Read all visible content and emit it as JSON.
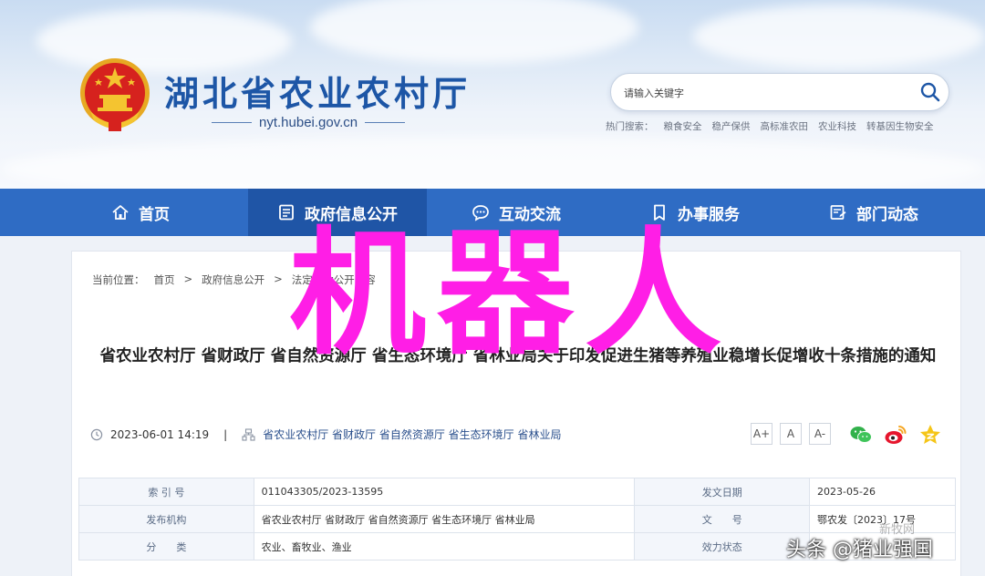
{
  "header": {
    "site_title": "湖北省农业农村厅",
    "site_domain": "nyt.hubei.gov.cn",
    "search_placeholder": "请输入关键字",
    "hot_label": "热门搜索：",
    "hot_terms": [
      "粮食安全",
      "稳产保供",
      "高标准农田",
      "农业科技",
      "转基因生物安全"
    ]
  },
  "nav": {
    "items": [
      {
        "label": "首页",
        "icon": "home-icon"
      },
      {
        "label": "政府信息公开",
        "icon": "document-icon"
      },
      {
        "label": "互动交流",
        "icon": "chat-icon"
      },
      {
        "label": "办事服务",
        "icon": "bookmark-icon"
      },
      {
        "label": "部门动态",
        "icon": "news-icon"
      }
    ],
    "active_index": 1,
    "bg_color": "#2f6cc4"
  },
  "breadcrumb": {
    "prefix": "当前位置：",
    "items": [
      "首页",
      "政府信息公开",
      "法定主动公开内容"
    ]
  },
  "article": {
    "title": "省农业农村厅 省财政厅 省自然资源厅 省生态环境厅 省林业局关于印发促进生猪等养殖业稳增长促增收十条措施的通知",
    "date": "2023-06-01 14:19",
    "separator": "|",
    "publishers": "省农业农村厅 省财政厅 省自然资源厅 省生态环境厅 省林业局",
    "font_sizes": [
      "A+",
      "A",
      "A-"
    ]
  },
  "info_table": {
    "index_label": "索 引 号",
    "index_value": "011043305/2023-13595",
    "issue_date_label": "发文日期",
    "issue_date_value": "2023-05-26",
    "issuer_label": "发布机构",
    "issuer_value": "省农业农村厅 省财政厅 省自然资源厅 省生态环境厅 省林业局",
    "doc_no_label": "文　　号",
    "doc_no_value": "鄂农发〔2023〕17号",
    "category_label": "分　　类",
    "category_value": "农业、畜牧业、渔业",
    "status_label": "效力状态",
    "status_value": ""
  },
  "watermarks": {
    "big": "机器人",
    "faint": "新牧网",
    "small": "头条 @猪业强国"
  }
}
